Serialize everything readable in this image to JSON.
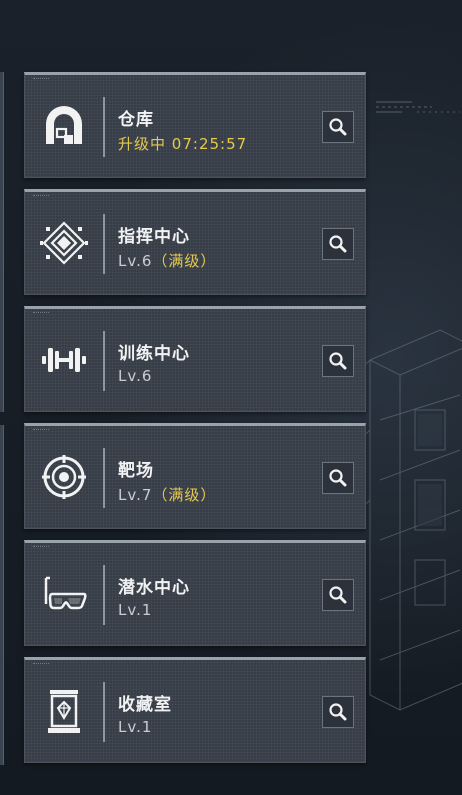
{
  "buildings": [
    {
      "name": "仓库",
      "status_prefix": "升级中",
      "status_value": "07:25:57",
      "icon": "warehouse-icon"
    },
    {
      "name": "指挥中心",
      "level": "Lv.6",
      "badge": "（满级）",
      "icon": "command-center-icon"
    },
    {
      "name": "训练中心",
      "level": "Lv.6",
      "icon": "dumbbell-icon"
    },
    {
      "name": "靶场",
      "level": "Lv.7",
      "badge": "（满级）",
      "icon": "target-icon"
    },
    {
      "name": "潜水中心",
      "level": "Lv.1",
      "icon": "diving-mask-icon"
    },
    {
      "name": "收藏室",
      "level": "Lv.1",
      "icon": "collection-case-icon"
    }
  ],
  "colors": {
    "accent": "#e6c84d",
    "card": "#363d47",
    "text": "#f1f2f3",
    "subtext": "#c9cdd2"
  },
  "search_icon": "magnifier-icon"
}
